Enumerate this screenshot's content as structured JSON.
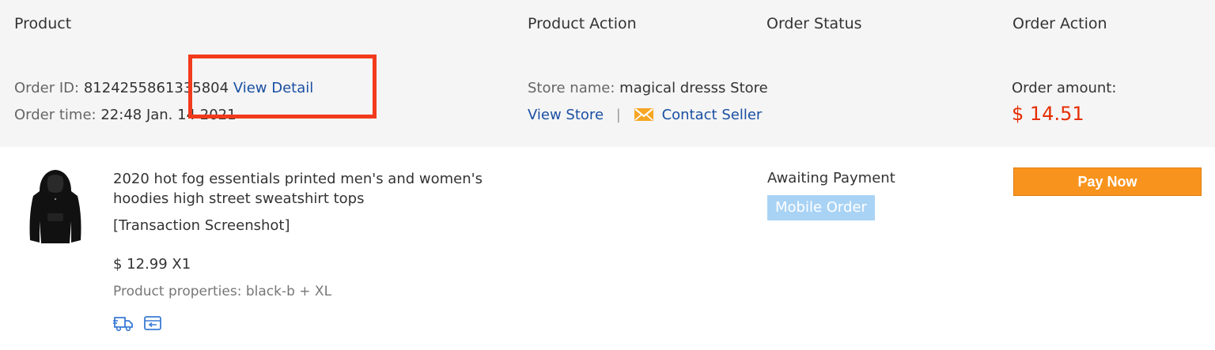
{
  "header": {
    "col_product": "Product",
    "col_product_action": "Product Action",
    "col_order_status": "Order Status",
    "col_order_action": "Order Action"
  },
  "order": {
    "id_label": "Order ID:",
    "id_value": "8124255861335804",
    "view_detail": "View Detail",
    "time_label": "Order time:",
    "time_value": "22:48 Jan. 14 2021",
    "store_label": "Store name:",
    "store_value": "magical dresss Store",
    "view_store": "View Store",
    "separator": "|",
    "contact_seller": "Contact Seller",
    "amount_label": "Order amount:",
    "amount_value": "$ 14.51"
  },
  "item": {
    "title": "2020 hot fog essentials printed men's and women's hoodies high street sweatshirt tops",
    "snapshot": "[Transaction Screenshot]",
    "price_qty": "$ 12.99 X1",
    "properties": "Product properties: black-b + XL",
    "icons": [
      "delivery-truck-icon",
      "return-icon"
    ]
  },
  "status": {
    "text": "Awaiting Payment",
    "badge": "Mobile Order"
  },
  "action": {
    "pay_now": "Pay Now"
  },
  "colors": {
    "header_bg": "#f5f5f5",
    "link": "#1a4fa3",
    "amount": "#e62e04",
    "pay_button": "#f8941d",
    "badge": "#a9d3f5",
    "highlight_box": "#f23a1c"
  }
}
